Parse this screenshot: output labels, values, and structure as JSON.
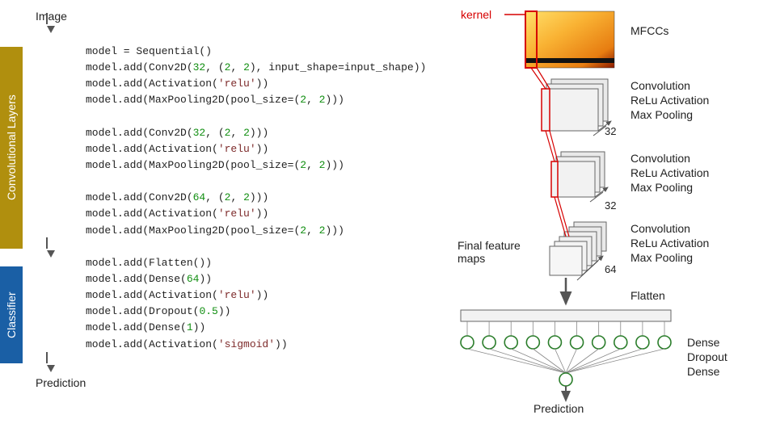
{
  "left": {
    "flow_top": "Image",
    "flow_bottom": "Prediction",
    "bar_conv": "Convolutional Layers",
    "bar_clf": "Classifier",
    "code": {
      "l1a": "model = Sequential()",
      "l2a": "model.add(Conv2D(",
      "l2b": "32",
      "l2c": ", (",
      "l2d": "2",
      "l2e": ", ",
      "l2f": "2",
      "l2g": "), input_shape=input_shape))",
      "l3a": "model.add(Activation(",
      "l3b": "'relu'",
      "l3c": "))",
      "l4a": "model.add(MaxPooling2D(pool_size=(",
      "l4b": "2",
      "l4c": ", ",
      "l4d": "2",
      "l4e": ")))",
      "l6a": "model.add(Conv2D(",
      "l6b": "32",
      "l6c": ", (",
      "l6d": "2",
      "l6e": ", ",
      "l6f": "2",
      "l6g": ")))",
      "l7a": "model.add(Activation(",
      "l7b": "'relu'",
      "l7c": "))",
      "l8a": "model.add(MaxPooling2D(pool_size=(",
      "l8b": "2",
      "l8c": ", ",
      "l8d": "2",
      "l8e": ")))",
      "l10a": "model.add(Conv2D(",
      "l10b": "64",
      "l10c": ", (",
      "l10d": "2",
      "l10e": ", ",
      "l10f": "2",
      "l10g": ")))",
      "l11a": "model.add(Activation(",
      "l11b": "'relu'",
      "l11c": "))",
      "l12a": "model.add(MaxPooling2D(pool_size=(",
      "l12b": "2",
      "l12c": ", ",
      "l12d": "2",
      "l12e": ")))",
      "l14a": "model.add(Flatten())",
      "l15a": "model.add(Dense(",
      "l15b": "64",
      "l15c": "))",
      "l16a": "model.add(Activation(",
      "l16b": "'relu'",
      "l16c": "))",
      "l17a": "model.add(Dropout(",
      "l17b": "0.5",
      "l17c": "))",
      "l18a": "model.add(Dense(",
      "l18b": "1",
      "l18c": "))",
      "l19a": "model.add(Activation(",
      "l19b": "'sigmoid'",
      "l19c": "))"
    }
  },
  "right": {
    "kernel": "kernel",
    "mfcc": "MFCCs",
    "block1": {
      "l1": "Convolution",
      "l2": "ReLu Activation",
      "l3": "Max Pooling",
      "n": "32"
    },
    "block2": {
      "l1": "Convolution",
      "l2": "ReLu Activation",
      "l3": "Max Pooling",
      "n": "32"
    },
    "block3": {
      "l1": "Convolution",
      "l2": "ReLu Activation",
      "l3": "Max Pooling",
      "n": "64"
    },
    "final_maps": "Final feature\nmaps",
    "flatten": "Flatten",
    "dense1": "Dense",
    "dropout": "Dropout",
    "dense2": "Dense",
    "prediction": "Prediction"
  },
  "diagram": {
    "layers": [
      {
        "name": "conv-block-1",
        "filters": 32,
        "ops": [
          "Convolution",
          "ReLu Activation",
          "Max Pooling"
        ]
      },
      {
        "name": "conv-block-2",
        "filters": 32,
        "ops": [
          "Convolution",
          "ReLu Activation",
          "Max Pooling"
        ]
      },
      {
        "name": "conv-block-3",
        "filters": 64,
        "ops": [
          "Convolution",
          "ReLu Activation",
          "Max Pooling"
        ]
      },
      {
        "name": "flatten"
      },
      {
        "name": "dense",
        "units": 64,
        "activation": "relu"
      },
      {
        "name": "dropout",
        "rate": 0.5
      },
      {
        "name": "dense",
        "units": 1,
        "activation": "sigmoid"
      }
    ],
    "dense_nodes_shown": 10,
    "colors": {
      "kernel": "#d60000",
      "conv_bar": "#b08f0e",
      "clf_bar": "#1a5fa5",
      "node": "#2a7d2a"
    }
  }
}
